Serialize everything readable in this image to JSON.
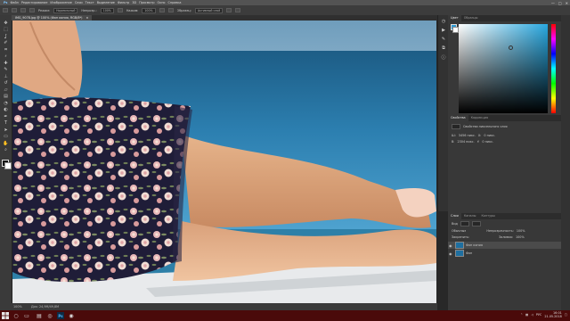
{
  "app": {
    "name": "Adobe Photoshop"
  },
  "menubar": {
    "items": [
      "Файл",
      "Редактирование",
      "Изображение",
      "Слои",
      "Текст",
      "Выделение",
      "Фильтр",
      "3D",
      "Просмотр",
      "Окно",
      "Справка"
    ],
    "window_controls": [
      "—",
      "□",
      "✕"
    ]
  },
  "options": {
    "blend_label": "Режим:",
    "blend_value": "Нормальный",
    "opacity_label": "Непрозр.:",
    "opacity_value": "100%",
    "flow_label": "Нажим:",
    "flow_value": "100%",
    "sample_label": "Образец:",
    "sample_value": "Активный слой"
  },
  "document": {
    "tab_title": "IMG_9078.jpg @ 100% (Фон копия, RGB/8*)",
    "close_glyph": "×"
  },
  "status": {
    "zoom": "100%",
    "doc_info": "Док: 24,9M/49,8M"
  },
  "panels": {
    "color_tabs": [
      "Цвет",
      "Образцы"
    ],
    "props_tabs": [
      "Свойства",
      "Коррекция"
    ],
    "props_title": "Свойства пиксельного слоя",
    "props_rows": [
      {
        "a": "Ш:",
        "a_val": "3456 пикс.",
        "b": "Х:",
        "b_val": "0 пикс."
      },
      {
        "a": "В:",
        "a_val": "2304 пикс.",
        "b": "Y:",
        "b_val": "0 пикс."
      }
    ],
    "layers_tabs": [
      "Слои",
      "Каналы",
      "Контуры"
    ],
    "layers_kind": "Вид",
    "blend_mode": "Обычные",
    "opacity_label": "Непрозрачность:",
    "opacity_value": "100%",
    "lock_label": "Закрепить:",
    "fill_label": "Заливка:",
    "fill_value": "100%",
    "layers": [
      {
        "name": "Фон копия",
        "selected": true
      },
      {
        "name": "Фон",
        "selected": false
      }
    ]
  },
  "taskbar": {
    "lang": "РУС",
    "time": "16:01",
    "date": "21.05.2018"
  },
  "colors": {
    "accent": "#2e9ad4",
    "taskbar": "#4a0a0a",
    "panel": "#383838"
  },
  "icons": {
    "tools": [
      "move-icon",
      "marquee-icon",
      "lasso-icon",
      "quick-select-icon",
      "crop-icon",
      "eyedropper-icon",
      "healing-icon",
      "brush-icon",
      "stamp-icon",
      "history-brush-icon",
      "eraser-icon",
      "gradient-icon",
      "blur-icon",
      "dodge-icon",
      "pen-icon",
      "type-icon",
      "path-select-icon",
      "shape-icon",
      "hand-icon",
      "zoom-icon"
    ]
  }
}
